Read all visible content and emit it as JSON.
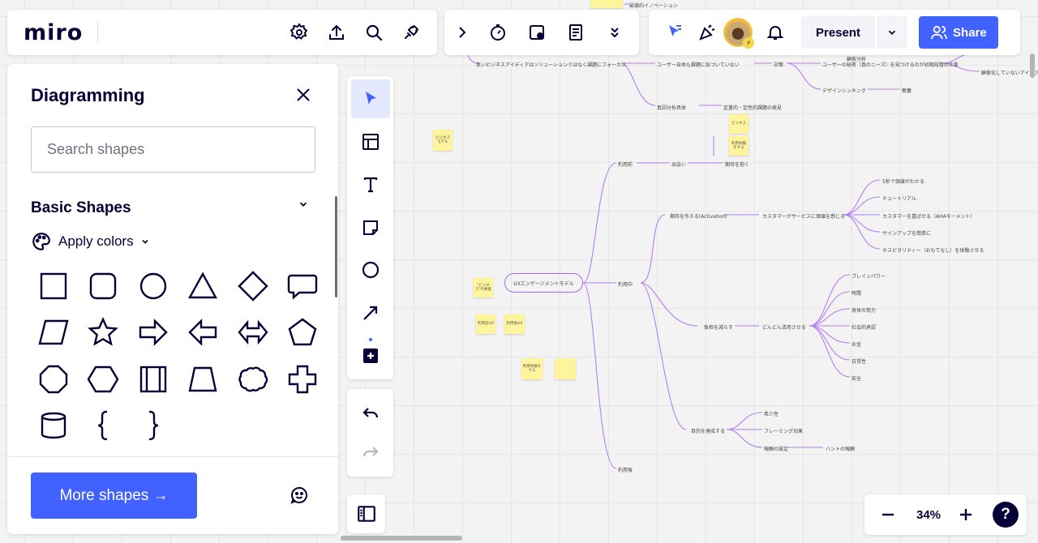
{
  "topbar": {
    "logo": "miro",
    "tools": [
      "settings-icon",
      "upload-icon",
      "search-icon",
      "plugin-icon"
    ]
  },
  "topbar_mid": {
    "tools": [
      "expand-chevron-icon",
      "timer-icon",
      "card-icon",
      "notes-icon",
      "more-chevron-icon"
    ]
  },
  "topbar_right": {
    "present_label": "Present",
    "share_label": "Share",
    "accent_color": "#4262ff"
  },
  "diagram_panel": {
    "title": "Diagramming",
    "search_placeholder": "Search shapes",
    "section_title": "Basic Shapes",
    "apply_colors_label": "Apply colors",
    "shapes": [
      "square",
      "rounded-square",
      "circle",
      "triangle",
      "diamond",
      "speech-bubble",
      "parallelogram",
      "star",
      "arrow-right",
      "arrow-left",
      "arrow-double",
      "pentagon",
      "octagon",
      "hexagon",
      "frame-columns",
      "trapezoid",
      "cloud",
      "cross",
      "cylinder",
      "brace-left",
      "brace-right"
    ],
    "more_shapes_label": "More shapes →"
  },
  "toolbar": {
    "tools": [
      "select-cursor-icon",
      "templates-icon",
      "text-icon",
      "sticky-note-icon",
      "shape-circle-icon",
      "arrow-line-icon",
      "add-more-icon"
    ],
    "undo": "undo-icon",
    "redo": "redo-icon",
    "frames": "frames-panel-icon"
  },
  "zoom": {
    "minus": "−",
    "level": "34%",
    "plus": "+",
    "help": "?"
  },
  "mindmap": {
    "root": "UXエンゲージメントモデル",
    "top_items": [
      "良いビジネスアイディアはソリューションではなく課題にフォーカス",
      "ユーザー自体も課題に気づいていない",
      "対策",
      "ユーザーの秘密（真のニーズ）を見つけるのが初期段階の仕事",
      "デザインシンキング",
      "教養",
      "真因分析具体",
      "定量的・定性的課題の発見",
      "破壊的イノベーション",
      "顧客分析",
      "顧客化していないアイデア"
    ],
    "branch1": {
      "label": "利用前",
      "child": "出会い",
      "grand": "期待を抱く"
    },
    "branch2": {
      "label": "利用中",
      "child1": "期待を作える(Activation)",
      "child1_grand": "カスタマーがサービスに価値を感じる",
      "leaves1": [
        "5秒で価値がわかる",
        "チュートリアル",
        "カスタマーを喜ばせる（AHAモーメント）",
        "サインアップを簡単に",
        "ホスピタリティー（おもてなし）を体験させる"
      ],
      "child2": "負担を減らす",
      "child2_grand": "どんどん活用させる",
      "leaves2": [
        "ブレインパワー",
        "時間",
        "身体の努力",
        "社会的承認",
        "お金",
        "日常性",
        "安全"
      ],
      "child3": "目的を達成する",
      "leaves3": [
        "希少性",
        "フレーミング効果",
        "報酬の設定"
      ],
      "leaf3_extra": "ハントの報酬"
    },
    "branch3": {
      "label": "利用後"
    },
    "stickies": [
      "\"ビジネス\"の要素",
      "利用前UX",
      "利用後UX",
      "ビジネス",
      "利用体験をする",
      "利用体験をする",
      "ビジネスモデル"
    ]
  }
}
